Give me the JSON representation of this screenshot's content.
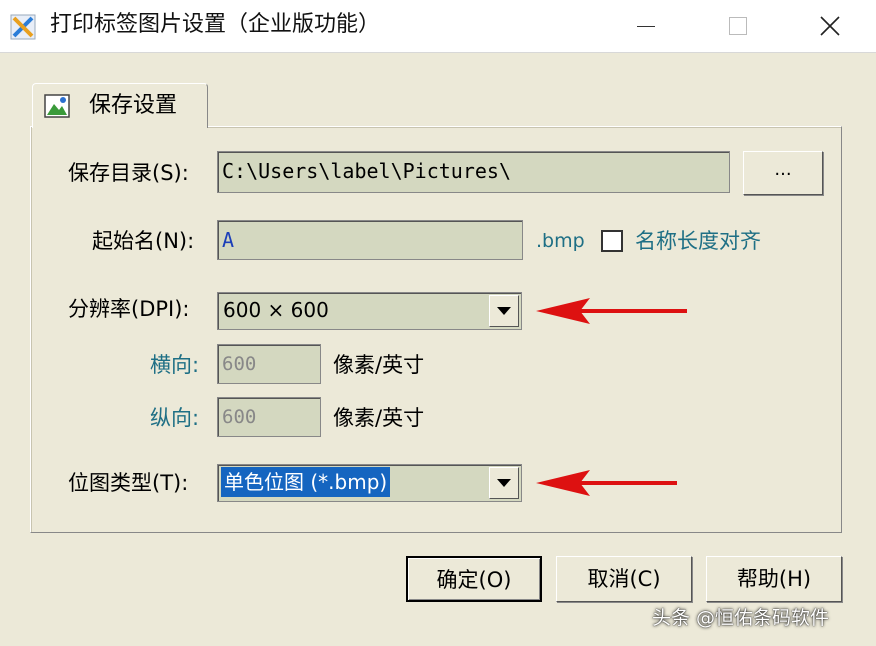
{
  "window": {
    "title": "打印标签图片设置（企业版功能）"
  },
  "tab": {
    "label": "保存设置"
  },
  "save_dir": {
    "label": "保存目录(S):",
    "value": "C:\\Users\\label\\Pictures\\",
    "browse_label": "..."
  },
  "start_name": {
    "label": "起始名(N):",
    "value": "A",
    "ext": ".bmp",
    "align_checkbox_label": "名称长度对齐",
    "align_checked": false
  },
  "resolution": {
    "label": "分辨率(DPI):",
    "selected": "600 × 600",
    "horizontal_label": "横向:",
    "horizontal_value": "600",
    "horizontal_unit": "像素/英寸",
    "vertical_label": "纵向:",
    "vertical_value": "600",
    "vertical_unit": "像素/英寸"
  },
  "bitmap_type": {
    "label": "位图类型(T):",
    "selected": "单色位图 (*.bmp)"
  },
  "buttons": {
    "ok": "确定(O)",
    "cancel": "取消(C)",
    "help": "帮助(H)"
  },
  "watermark": "头条 @恒佑条码软件",
  "colors": {
    "annotation_arrow": "#dd1111",
    "selection": "#1565c0",
    "teal_label": "#1e6f85"
  }
}
